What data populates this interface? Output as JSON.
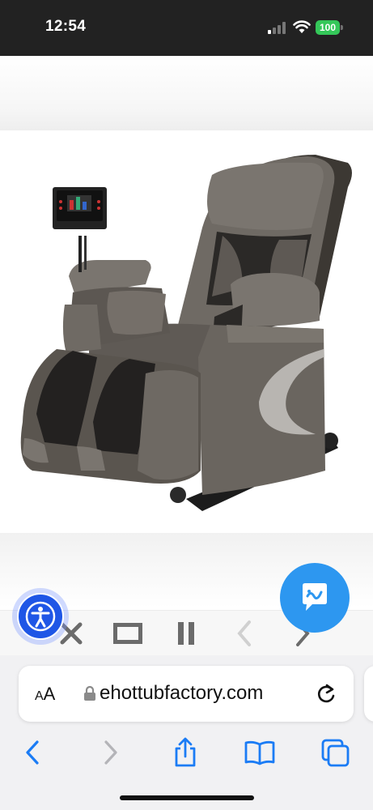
{
  "status_bar": {
    "time": "12:54",
    "battery_level": "100",
    "battery_color": "#34c759"
  },
  "media_controls": {
    "icons": [
      "close-icon",
      "fullscreen-icon",
      "pause-icon",
      "previous-icon",
      "next-icon"
    ]
  },
  "accessibility": {
    "icon": "accessibility-person-icon",
    "color": "#1f56e6"
  },
  "chat": {
    "icon": "chat-bubble-icon",
    "color": "#2d97f0"
  },
  "address_bar": {
    "text_size_label_large": "A",
    "text_size_label_small": "A",
    "url": "ehottubfactory.com",
    "secure_icon": "lock-icon",
    "reload_icon": "reload-icon"
  },
  "toolbar": {
    "icons": [
      "back-icon",
      "forward-icon",
      "share-icon",
      "bookmarks-icon",
      "tabs-icon"
    ],
    "accent": "#1b7cf5"
  },
  "product_image": {
    "subject": "massage-chair",
    "alt": ""
  }
}
